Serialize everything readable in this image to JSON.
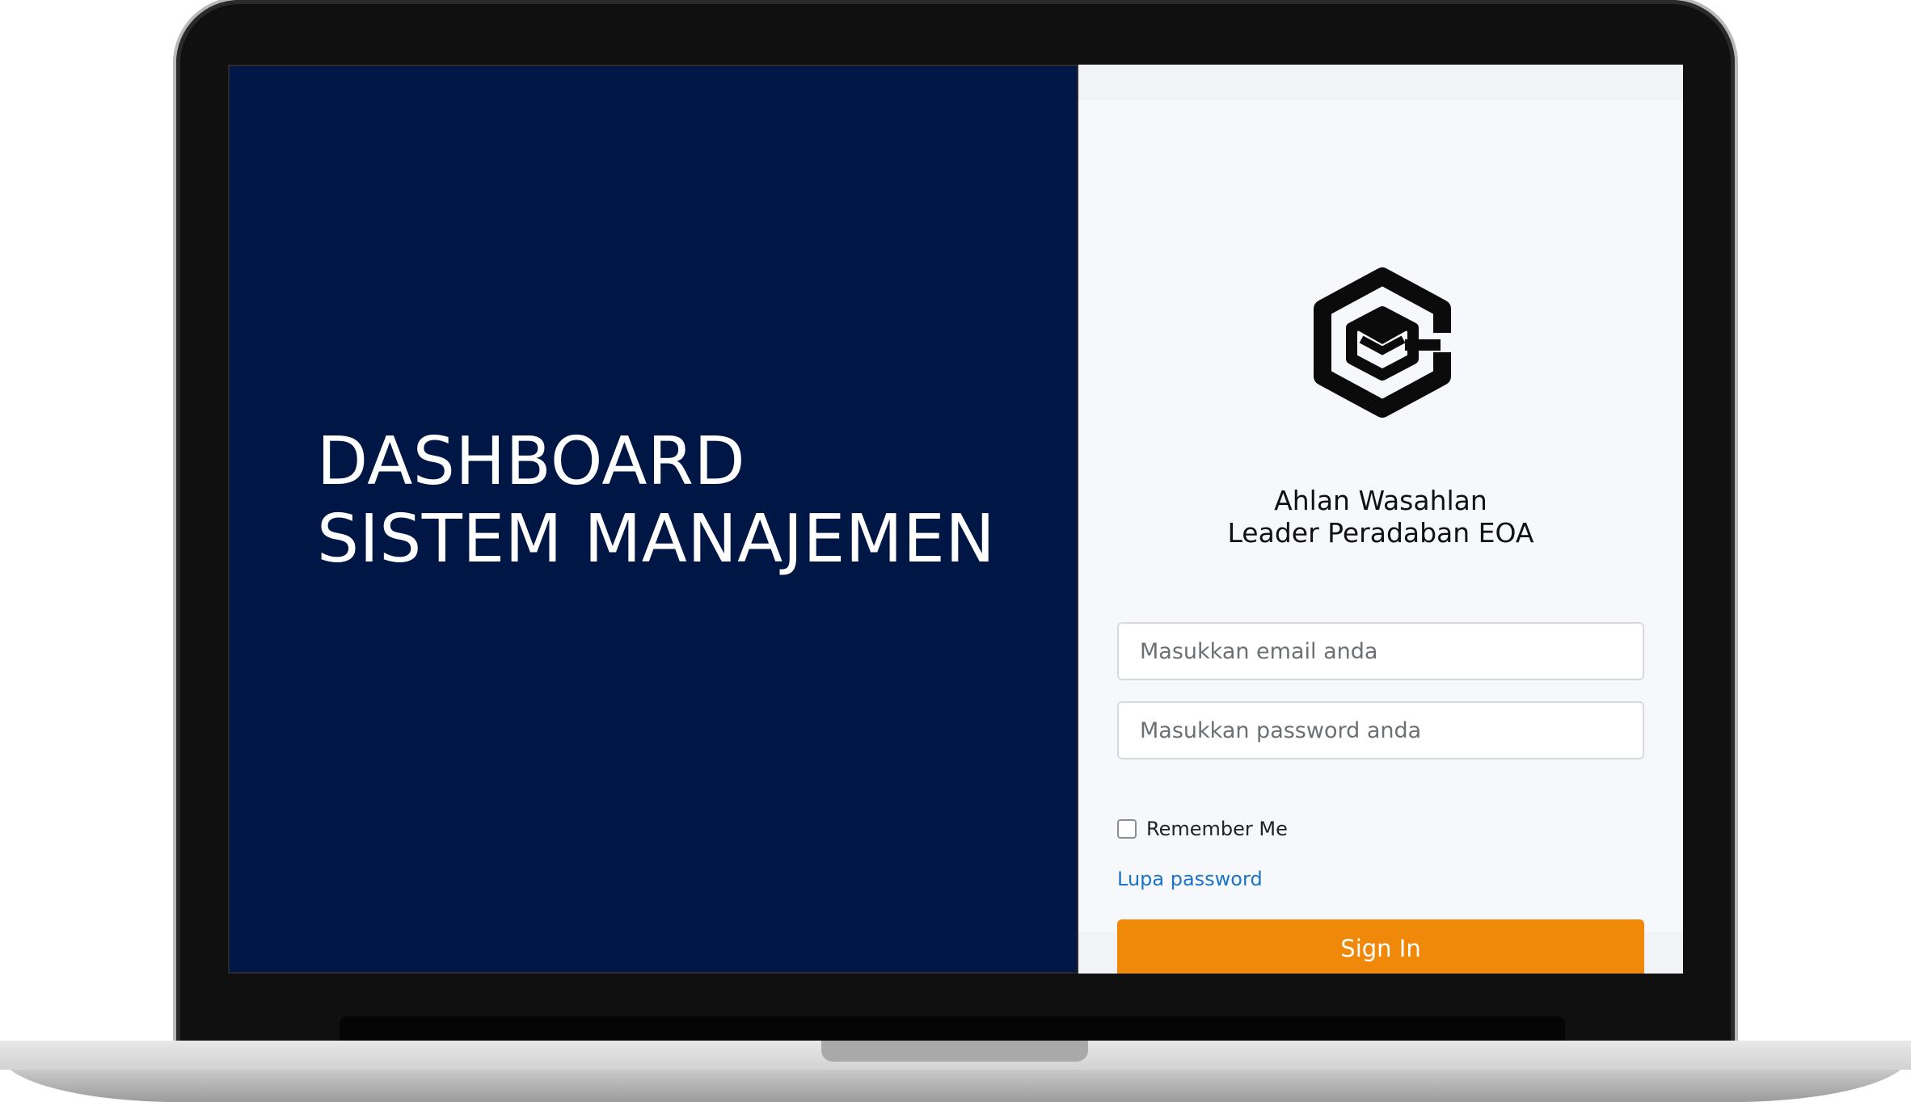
{
  "hero": {
    "line1": "DASHBOARD",
    "line2": "SISTEM MANAJEMEN"
  },
  "login": {
    "logo_icon": "eoa-hexagon-logo-icon",
    "welcome_line1": "Ahlan Wasahlan",
    "welcome_line2": "Leader Peradaban EOA",
    "email_placeholder": "Masukkan email anda",
    "email_value": "",
    "password_placeholder": "Masukkan password anda",
    "password_value": "",
    "remember_label": "Remember Me",
    "remember_checked": false,
    "forgot_label": "Lupa password",
    "signin_label": "Sign In"
  },
  "colors": {
    "hero_background": "#001746",
    "panel_background": "#f7f8fb",
    "signin_button": "#f0880a",
    "link": "#1a73c8"
  }
}
